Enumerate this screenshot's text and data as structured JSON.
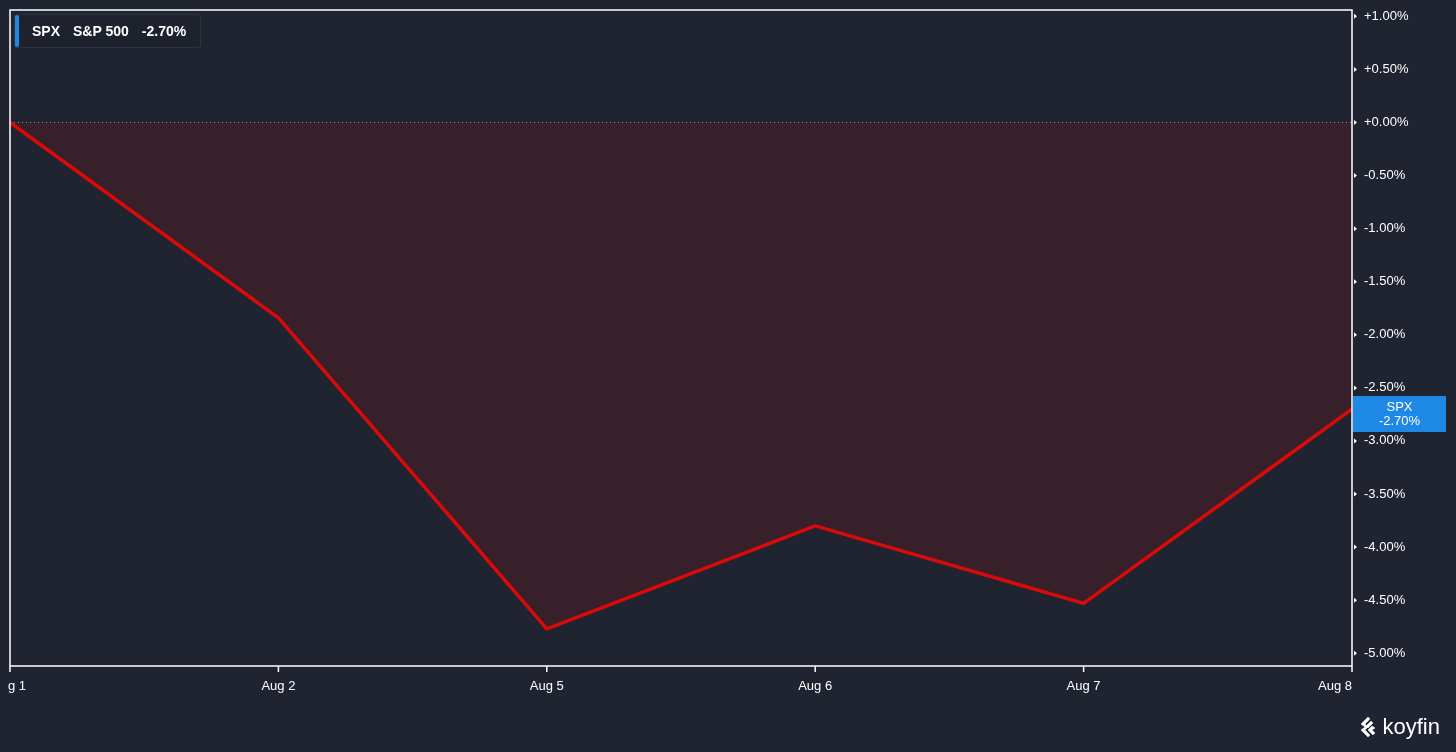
{
  "legend": {
    "symbol": "SPX",
    "name": "S&P 500",
    "change": "-2.70%",
    "color": "#1e88e5"
  },
  "chart": {
    "chart_data": {
      "type": "area",
      "categories": [
        "g 1",
        "Aug 2",
        "Aug 5",
        "Aug 6",
        "Aug 7",
        "Aug 8"
      ],
      "series": [
        {
          "name": "SPX",
          "color": "#d90a0a",
          "values": [
            0,
            -1.84,
            -4.77,
            -3.8,
            -4.53,
            -2.7
          ]
        }
      ],
      "ylim": [
        -5.12,
        1.06
      ],
      "yticks": [
        {
          "value": 1,
          "label": "+1.00%"
        },
        {
          "value": 0.5,
          "label": "+0.50%"
        },
        {
          "value": 0,
          "label": "+0.00%"
        },
        {
          "value": -0.5,
          "label": "-0.50%"
        },
        {
          "value": -1,
          "label": "-1.00%"
        },
        {
          "value": -1.5,
          "label": "-1.50%"
        },
        {
          "value": -2,
          "label": "-2.00%"
        },
        {
          "value": -2.5,
          "label": "-2.50%"
        },
        {
          "value": -3,
          "label": "-3.00%"
        },
        {
          "value": -3.5,
          "label": "-3.50%"
        },
        {
          "value": -4,
          "label": "-4.00%"
        },
        {
          "value": -4.5,
          "label": "-4.50%"
        },
        {
          "value": -5,
          "label": "-5.00%"
        }
      ]
    },
    "last_value_badge": {
      "value": "-2.70%"
    }
  },
  "logo": {
    "text": "koyfin"
  }
}
